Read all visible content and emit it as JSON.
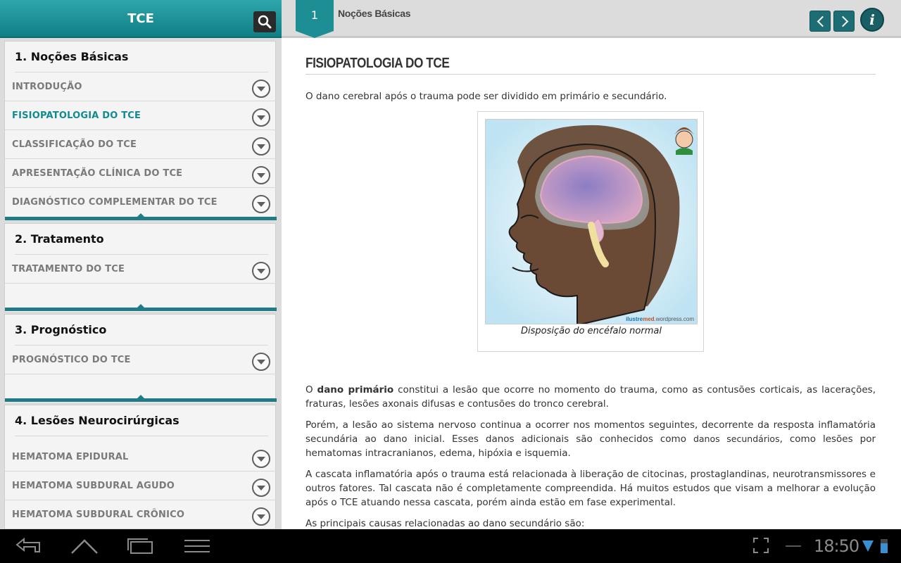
{
  "app": {
    "title": "TCE"
  },
  "sidebar": {
    "sections": [
      {
        "title": "1. Noções Básicas",
        "items": [
          {
            "label": "INTRODUÇÃO"
          },
          {
            "label": "FISIOPATOLOGIA DO TCE",
            "active": true
          },
          {
            "label": "CLASSIFICAÇÃO DO TCE"
          },
          {
            "label": "APRESENTAÇÃO CLÍNICA DO TCE"
          },
          {
            "label": "DIAGNÓSTICO COMPLEMENTAR DO TCE"
          }
        ]
      },
      {
        "title": "2. Tratamento",
        "items": [
          {
            "label": "TRATAMENTO DO TCE"
          }
        ]
      },
      {
        "title": "3. Prognóstico",
        "items": [
          {
            "label": "PROGNÓSTICO DO TCE"
          }
        ]
      },
      {
        "title": "4. Lesões Neurocirúrgicas",
        "items": [
          {
            "label": "HEMATOMA EPIDURAL"
          },
          {
            "label": "HEMATOMA SUBDURAL AGUDO"
          },
          {
            "label": "HEMATOMA SUBDURAL CRÔNICO"
          }
        ]
      }
    ]
  },
  "topbar": {
    "page_number": "1",
    "section_name": "Noções Básicas"
  },
  "article": {
    "title": "FISIOPATOLOGIA DO TCE",
    "intro": "O dano cerebral após o trauma pode ser dividido em primário e secundário.",
    "figure": {
      "caption": "Disposição do encéfalo normal",
      "watermark_a": "ilustre",
      "watermark_b": "med",
      "watermark_c": ".wordpress.com"
    },
    "p1_a": "O ",
    "p1_bold": "dano primário",
    "p1_b": " constitui a lesão que ocorre no momento do trauma, como as contusões corticais, as lacerações, fraturas, lesões axonais difusas e contusões do tronco cerebral.",
    "p2_a": "Porém, a lesão ao sistema nervoso continua a ocorrer nos momentos seguintes, decorrente da resposta inflamatória secundária ao dano inicial. Esses danos adicionais são conhecidos como ",
    "p2_small": "danos secundários",
    "p2_b": ", como lesões por hematomas intracranianos, edema, hipóxia e isquemia.",
    "p3": "A cascata inflamatória após o trauma está relacionada à liberação de citocinas, prostaglandinas, neurotransmissores e outros fatores. Tal cascata não é completamente compreendida. Há muitos estudos que visam a melhorar a evolução após o TCE atuando nessa cascata, porém ainda estão em fase experimental.",
    "p4": "As principais causas relacionadas ao dano secundário são:"
  },
  "system_bar": {
    "time": "18:50"
  },
  "colors": {
    "accent": "#138a91",
    "header_teal": "#1f8f95",
    "nav_dark": "#1d6d74"
  }
}
